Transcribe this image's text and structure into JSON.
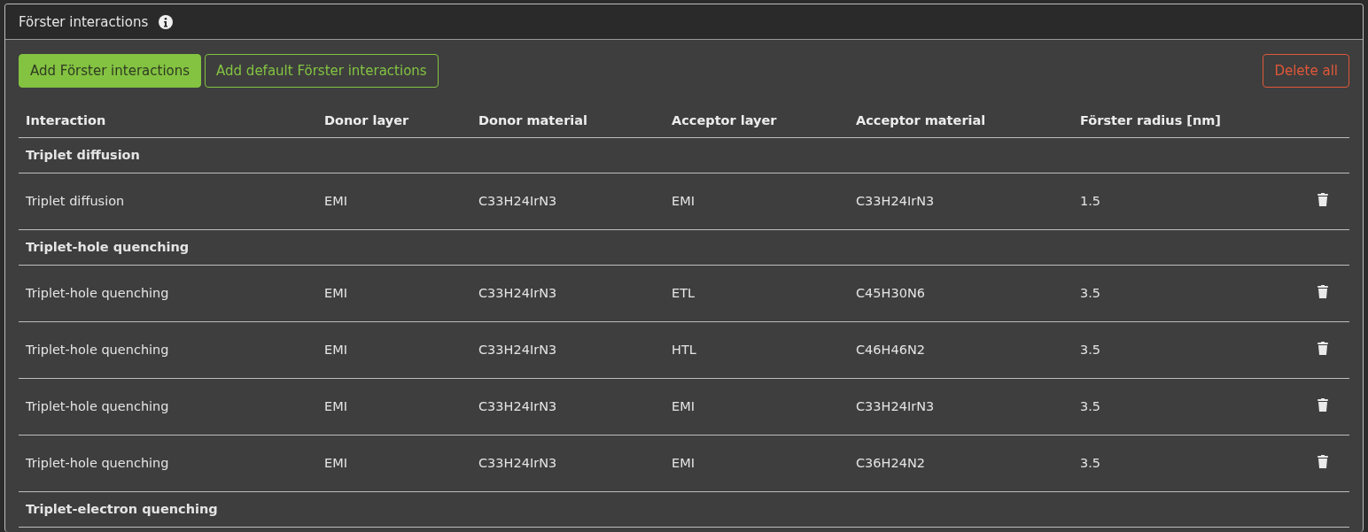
{
  "panel": {
    "title": "Förster interactions"
  },
  "toolbar": {
    "buttons": [
      {
        "label": "Add Förster interactions",
        "kind": "primary"
      },
      {
        "label": "Add default Förster interactions",
        "kind": "outline"
      },
      {
        "label": "Delete all",
        "kind": "danger"
      }
    ]
  },
  "table": {
    "columns": [
      "Interaction",
      "Donor layer",
      "Donor material",
      "Acceptor layer",
      "Acceptor material",
      "Förster radius [nm]"
    ],
    "rows": [
      {
        "kind": "group",
        "label": "Triplet diffusion"
      },
      {
        "kind": "data",
        "cells": [
          "Triplet diffusion",
          "EMI",
          "C33H24IrN3",
          "EMI",
          "C33H24IrN3",
          "1.5"
        ]
      },
      {
        "kind": "group",
        "label": "Triplet-hole quenching"
      },
      {
        "kind": "data",
        "cells": [
          "Triplet-hole quenching",
          "EMI",
          "C33H24IrN3",
          "ETL",
          "C45H30N6",
          "3.5"
        ]
      },
      {
        "kind": "data",
        "cells": [
          "Triplet-hole quenching",
          "EMI",
          "C33H24IrN3",
          "HTL",
          "C46H46N2",
          "3.5"
        ]
      },
      {
        "kind": "data",
        "cells": [
          "Triplet-hole quenching",
          "EMI",
          "C33H24IrN3",
          "EMI",
          "C33H24IrN3",
          "3.5"
        ]
      },
      {
        "kind": "data",
        "cells": [
          "Triplet-hole quenching",
          "EMI",
          "C33H24IrN3",
          "EMI",
          "C36H24N2",
          "3.5"
        ]
      },
      {
        "kind": "group",
        "label": "Triplet-electron quenching"
      }
    ]
  }
}
